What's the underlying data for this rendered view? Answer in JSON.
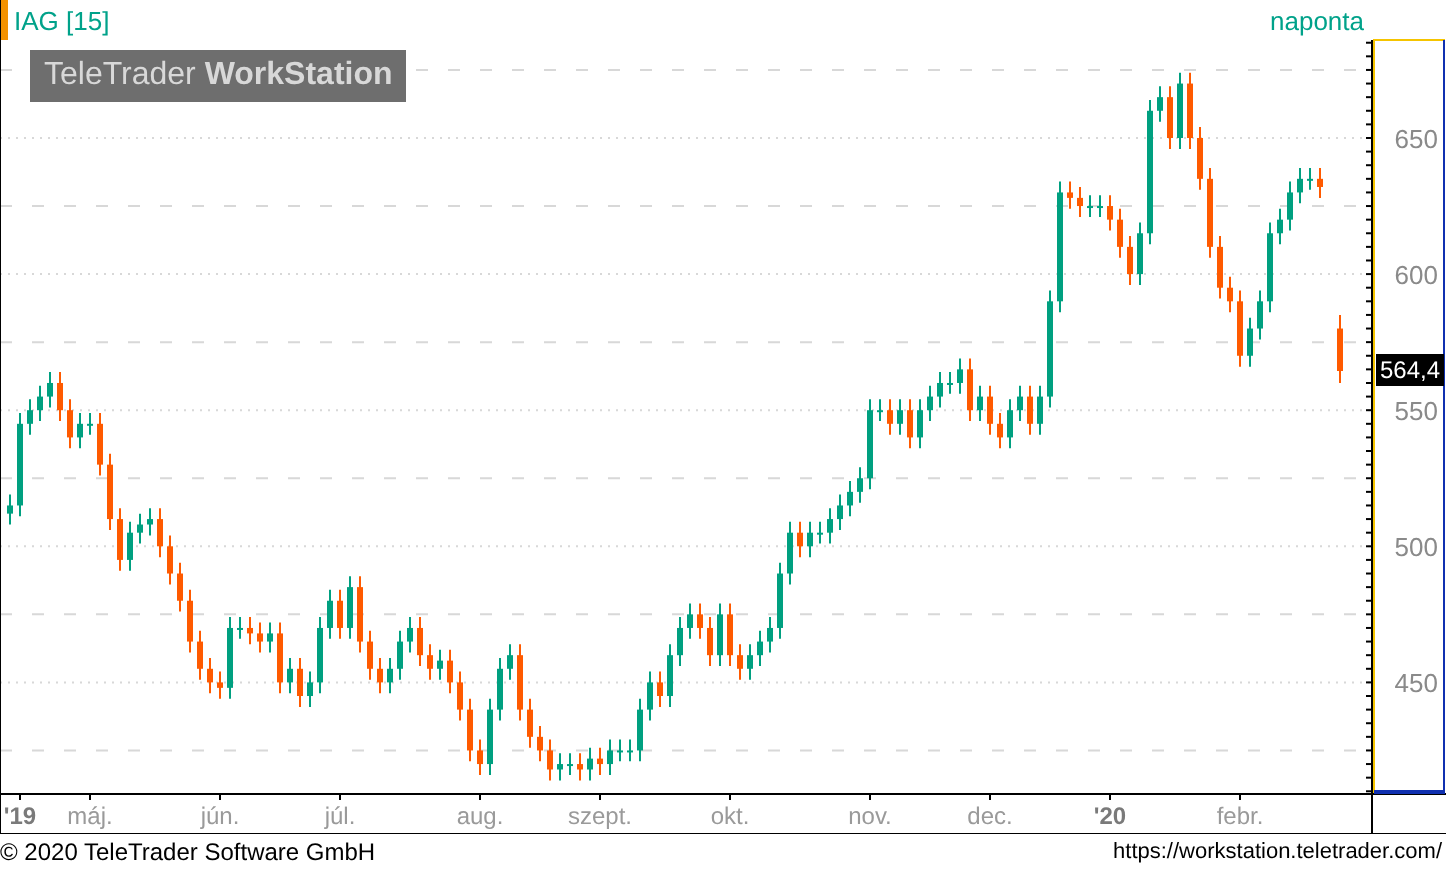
{
  "header": {
    "title": "IAG [15]",
    "interval": "naponta"
  },
  "logo": "TeleTrader **WorkStation**",
  "chart_data": {
    "type": "candlestick",
    "grid": true,
    "ylim": [
      409,
      686
    ],
    "yticks": [
      450,
      500,
      550,
      600,
      650
    ],
    "categories": [
      null,
      "'19",
      null,
      null,
      null,
      null,
      null,
      null,
      "máj.",
      null,
      null,
      null,
      null,
      null,
      null,
      null,
      null,
      null,
      null,
      null,
      null,
      "jún.",
      null,
      null,
      null,
      null,
      null,
      null,
      null,
      null,
      null,
      null,
      null,
      "júl.",
      null,
      null,
      null,
      null,
      null,
      null,
      null,
      null,
      null,
      null,
      null,
      null,
      null,
      "aug.",
      null,
      null,
      null,
      null,
      null,
      null,
      null,
      null,
      null,
      null,
      null,
      "szept.",
      null,
      null,
      null,
      null,
      null,
      null,
      null,
      null,
      null,
      null,
      null,
      null,
      "okt.",
      null,
      null,
      null,
      null,
      null,
      null,
      null,
      null,
      null,
      null,
      null,
      null,
      null,
      "nov.",
      null,
      null,
      null,
      null,
      null,
      null,
      null,
      null,
      null,
      null,
      null,
      "dec.",
      null,
      null,
      null,
      null,
      null,
      null,
      null,
      null,
      null,
      null,
      null,
      "'20",
      null,
      null,
      null,
      null,
      null,
      null,
      null,
      null,
      null,
      null,
      null,
      null,
      "febr.",
      null,
      null,
      null,
      null,
      null,
      null,
      null,
      null,
      null,
      null
    ],
    "ohlc": [
      [
        512,
        519,
        508,
        515
      ],
      [
        515,
        549,
        511,
        545
      ],
      [
        545,
        554,
        541,
        550
      ],
      [
        550,
        559,
        546,
        555
      ],
      [
        555,
        564,
        551,
        560
      ],
      [
        560,
        564,
        546,
        550
      ],
      [
        550,
        554,
        536,
        540
      ],
      [
        540,
        549,
        536,
        545
      ],
      [
        545,
        549,
        541,
        545
      ],
      [
        545,
        549,
        526,
        530
      ],
      [
        530,
        534,
        506,
        510
      ],
      [
        510,
        514,
        491,
        495
      ],
      [
        495,
        509,
        491,
        505
      ],
      [
        505,
        512,
        501,
        508
      ],
      [
        508,
        514,
        504,
        510
      ],
      [
        510,
        514,
        496,
        500
      ],
      [
        500,
        504,
        486,
        490
      ],
      [
        490,
        494,
        476,
        480
      ],
      [
        480,
        484,
        461,
        465
      ],
      [
        465,
        469,
        451,
        455
      ],
      [
        455,
        459,
        446,
        450
      ],
      [
        450,
        454,
        444,
        448
      ],
      [
        448,
        474,
        444,
        470
      ],
      [
        470,
        474,
        466,
        470
      ],
      [
        470,
        474,
        464,
        468
      ],
      [
        468,
        472,
        461,
        465
      ],
      [
        465,
        472,
        461,
        468
      ],
      [
        468,
        472,
        446,
        450
      ],
      [
        450,
        459,
        446,
        455
      ],
      [
        455,
        459,
        441,
        445
      ],
      [
        445,
        454,
        441,
        450
      ],
      [
        450,
        474,
        446,
        470
      ],
      [
        470,
        484,
        466,
        480
      ],
      [
        480,
        484,
        466,
        470
      ],
      [
        470,
        489,
        466,
        485
      ],
      [
        485,
        489,
        461,
        465
      ],
      [
        465,
        469,
        451,
        455
      ],
      [
        455,
        459,
        446,
        450
      ],
      [
        450,
        459,
        446,
        455
      ],
      [
        455,
        469,
        451,
        465
      ],
      [
        465,
        474,
        461,
        470
      ],
      [
        470,
        474,
        456,
        460
      ],
      [
        460,
        464,
        451,
        455
      ],
      [
        455,
        462,
        451,
        458
      ],
      [
        458,
        462,
        446,
        450
      ],
      [
        450,
        454,
        436,
        440
      ],
      [
        440,
        444,
        421,
        425
      ],
      [
        425,
        429,
        416,
        420
      ],
      [
        420,
        444,
        416,
        440
      ],
      [
        440,
        459,
        436,
        455
      ],
      [
        455,
        464,
        451,
        460
      ],
      [
        460,
        464,
        436,
        440
      ],
      [
        440,
        444,
        426,
        430
      ],
      [
        430,
        434,
        421,
        425
      ],
      [
        425,
        429,
        414,
        418
      ],
      [
        418,
        424,
        414,
        420
      ],
      [
        420,
        424,
        416,
        420
      ],
      [
        420,
        424,
        414,
        418
      ],
      [
        418,
        426,
        414,
        422
      ],
      [
        422,
        426,
        416,
        420
      ],
      [
        420,
        429,
        416,
        425
      ],
      [
        425,
        429,
        421,
        425
      ],
      [
        425,
        429,
        421,
        425
      ],
      [
        425,
        444,
        421,
        440
      ],
      [
        440,
        454,
        436,
        450
      ],
      [
        450,
        454,
        441,
        445
      ],
      [
        445,
        464,
        441,
        460
      ],
      [
        460,
        474,
        456,
        470
      ],
      [
        470,
        479,
        466,
        475
      ],
      [
        475,
        479,
        466,
        470
      ],
      [
        470,
        474,
        456,
        460
      ],
      [
        460,
        479,
        456,
        475
      ],
      [
        475,
        479,
        456,
        460
      ],
      [
        460,
        464,
        451,
        455
      ],
      [
        455,
        464,
        451,
        460
      ],
      [
        460,
        469,
        456,
        465
      ],
      [
        465,
        474,
        461,
        470
      ],
      [
        470,
        494,
        466,
        490
      ],
      [
        490,
        509,
        486,
        505
      ],
      [
        505,
        509,
        496,
        500
      ],
      [
        500,
        509,
        496,
        505
      ],
      [
        505,
        509,
        501,
        505
      ],
      [
        505,
        514,
        501,
        510
      ],
      [
        510,
        519,
        506,
        515
      ],
      [
        515,
        524,
        511,
        520
      ],
      [
        520,
        529,
        516,
        525
      ],
      [
        525,
        554,
        521,
        550
      ],
      [
        550,
        554,
        546,
        550
      ],
      [
        550,
        554,
        541,
        545
      ],
      [
        545,
        554,
        541,
        550
      ],
      [
        550,
        554,
        536,
        540
      ],
      [
        540,
        554,
        536,
        550
      ],
      [
        550,
        559,
        546,
        555
      ],
      [
        555,
        564,
        551,
        560
      ],
      [
        560,
        564,
        556,
        560
      ],
      [
        560,
        569,
        556,
        565
      ],
      [
        565,
        569,
        546,
        550
      ],
      [
        550,
        559,
        546,
        555
      ],
      [
        555,
        559,
        541,
        545
      ],
      [
        545,
        549,
        536,
        540
      ],
      [
        540,
        554,
        536,
        550
      ],
      [
        550,
        559,
        546,
        555
      ],
      [
        555,
        559,
        541,
        545
      ],
      [
        545,
        559,
        541,
        555
      ],
      [
        555,
        594,
        551,
        590
      ],
      [
        590,
        634,
        586,
        630
      ],
      [
        630,
        634,
        624,
        628
      ],
      [
        628,
        632,
        621,
        625
      ],
      [
        625,
        629,
        621,
        625
      ],
      [
        625,
        629,
        621,
        625
      ],
      [
        625,
        629,
        616,
        620
      ],
      [
        620,
        624,
        606,
        610
      ],
      [
        610,
        614,
        596,
        600
      ],
      [
        600,
        619,
        596,
        615
      ],
      [
        615,
        664,
        611,
        660
      ],
      [
        660,
        669,
        656,
        665
      ],
      [
        665,
        669,
        646,
        650
      ],
      [
        650,
        674,
        646,
        670
      ],
      [
        670,
        674,
        646,
        650
      ],
      [
        650,
        654,
        631,
        635
      ],
      [
        635,
        639,
        606,
        610
      ],
      [
        610,
        614,
        591,
        595
      ],
      [
        595,
        599,
        586,
        590
      ],
      [
        590,
        594,
        566,
        570
      ],
      [
        570,
        584,
        566,
        580
      ],
      [
        580,
        594,
        576,
        590
      ],
      [
        590,
        619,
        586,
        615
      ],
      [
        615,
        624,
        611,
        620
      ],
      [
        620,
        634,
        616,
        630
      ],
      [
        630,
        639,
        626,
        635
      ],
      [
        635,
        639,
        631,
        635
      ],
      [
        635,
        639,
        628,
        632
      ],
      null,
      [
        580,
        585,
        560,
        564.4
      ]
    ]
  },
  "last_price": "564,4",
  "footer": {
    "copyright": "© 2020 TeleTrader Software GmbH",
    "url": "https://workstation.teletrader.com/"
  }
}
